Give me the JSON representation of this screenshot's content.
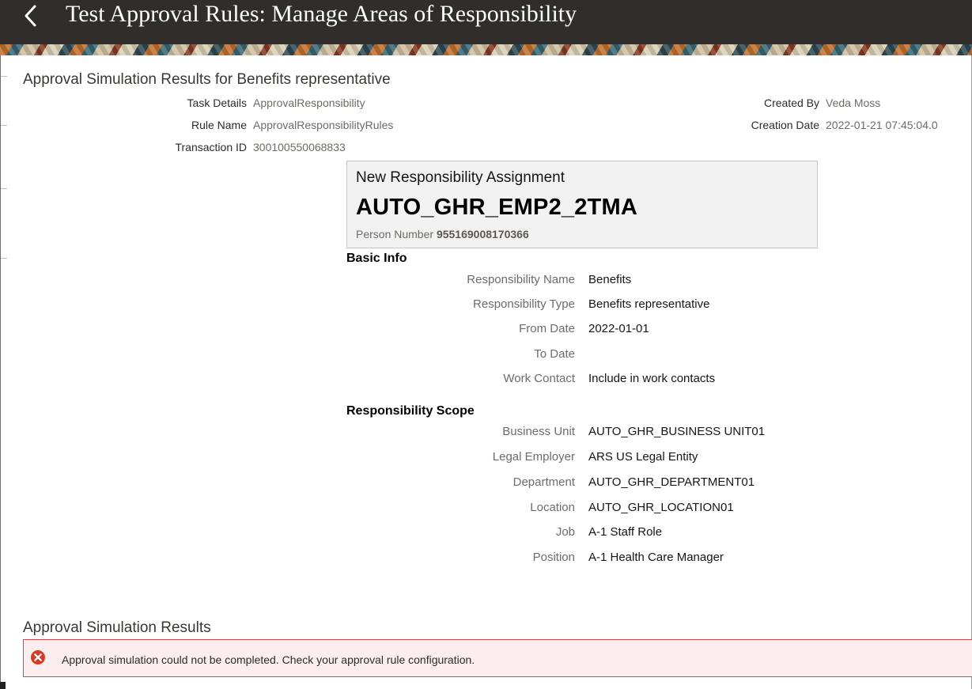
{
  "header": {
    "title": "Test Approval Rules: Manage Areas of Responsibility",
    "back_icon": "chevron-left-icon"
  },
  "summary": {
    "title": "Approval Simulation Results for Benefits representative",
    "task_details_label": "Task Details",
    "task_details_value": "ApprovalResponsibility",
    "rule_name_label": "Rule Name",
    "rule_name_value": "ApprovalResponsibilityRules",
    "transaction_id_label": "Transaction ID",
    "transaction_id_value": "300100550068833",
    "created_by_label": "Created By",
    "created_by_value": "Veda Moss",
    "creation_date_label": "Creation Date",
    "creation_date_value": "2022-01-21 07:45:04.0"
  },
  "card": {
    "title": "New Responsibility Assignment",
    "code": "AUTO_GHR_EMP2_2TMA",
    "person_number_label": "Person Number",
    "person_number_value": "955169008170366"
  },
  "basic_info": {
    "heading": "Basic Info",
    "fields": [
      {
        "label": "Responsibility Name",
        "value": "Benefits"
      },
      {
        "label": "Responsibility Type",
        "value": "Benefits representative"
      },
      {
        "label": "From Date",
        "value": "2022-01-01"
      },
      {
        "label": "To Date",
        "value": ""
      },
      {
        "label": "Work Contact",
        "value": "Include in work contacts"
      }
    ]
  },
  "scope": {
    "heading": "Responsibility Scope",
    "fields": [
      {
        "label": "Business Unit",
        "value": "AUTO_GHR_BUSINESS UNIT01"
      },
      {
        "label": "Legal Employer",
        "value": "ARS US Legal Entity"
      },
      {
        "label": "Department",
        "value": "AUTO_GHR_DEPARTMENT01"
      },
      {
        "label": "Location",
        "value": "AUTO_GHR_LOCATION01"
      },
      {
        "label": "Job",
        "value": "A-1 Staff Role"
      },
      {
        "label": "Position",
        "value": "A-1 Health Care Manager"
      }
    ]
  },
  "results": {
    "title": "Approval Simulation Results",
    "error_icon": "error-circle-icon",
    "error_message": "Approval simulation could not be completed. Check your approval rule configuration.",
    "error_color": "#d63b25"
  }
}
